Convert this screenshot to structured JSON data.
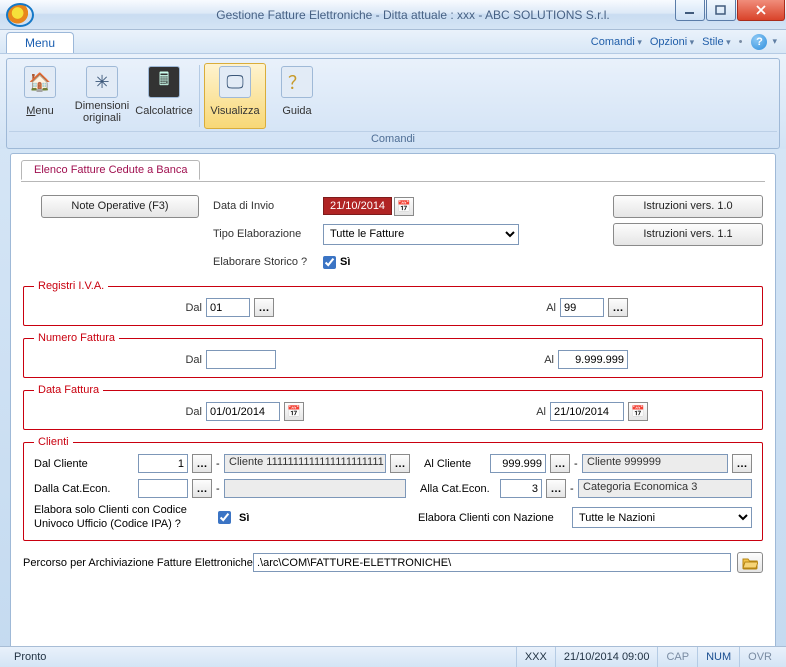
{
  "window": {
    "title": "Gestione Fatture Elettroniche - Ditta attuale : xxx - ABC SOLUTIONS S.r.l."
  },
  "menubar": {
    "tab": "Menu",
    "right": {
      "comandi": "Comandi",
      "opzioni": "Opzioni",
      "stile": "Stile"
    }
  },
  "ribbon": {
    "group_label": "Comandi",
    "buttons": {
      "menu": "Menu",
      "dimensioni": "Dimensioni originali",
      "calcolatrice": "Calcolatrice",
      "visualizza": "Visualizza",
      "guida": "Guida"
    }
  },
  "tab": {
    "title": "Elenco Fatture Cedute a Banca"
  },
  "buttons": {
    "note_operative": "Note Operative (F3)",
    "istruzioni_10": "Istruzioni vers. 1.0",
    "istruzioni_11": "Istruzioni vers. 1.1"
  },
  "labels": {
    "data_invio": "Data di Invio",
    "tipo_elab": "Tipo Elaborazione",
    "storico": "Elaborare Storico ?",
    "si": "Sì",
    "dal": "Dal",
    "al": "Al",
    "dal_cliente": "Dal Cliente",
    "al_cliente": "Al Cliente",
    "dalla_cat": "Dalla Cat.Econ.",
    "alla_cat": "Alla Cat.Econ.",
    "ipa": "Elabora solo Clienti con Codice Univoco Ufficio (Codice IPA) ?",
    "nazione": "Elabora Clienti con Nazione",
    "percorso": "Percorso per Archiviazione Fatture Elettroniche"
  },
  "fieldsets": {
    "registri": "Registri I.V.A.",
    "numfatt": "Numero Fattura",
    "datafatt": "Data Fattura",
    "clienti": "Clienti"
  },
  "values": {
    "data_invio": "21/10/2014",
    "tipo_elab": "Tutte le Fatture",
    "storico_checked": true,
    "reg_dal": "01",
    "reg_al": "99",
    "num_dal": "",
    "num_al": "9.999.999",
    "data_dal": "01/01/2014",
    "data_al": "21/10/2014",
    "cli_dal": "1",
    "cli_dal_desc": "Cliente 1111111111111111111111",
    "cli_al": "999.999",
    "cli_al_desc": "Cliente 999999",
    "cat_dal": "",
    "cat_dal_desc": "",
    "cat_al": "3",
    "cat_al_desc": "Categoria Economica 3",
    "ipa_checked": true,
    "nazione": "Tutte le Nazioni",
    "percorso": ".\\arc\\COM\\FATTURE-ELETTRONICHE\\"
  },
  "status": {
    "ready": "Pronto",
    "user": "XXX",
    "datetime": "21/10/2014  09:00",
    "cap": "CAP",
    "num": "NUM",
    "ovr": "OVR"
  }
}
